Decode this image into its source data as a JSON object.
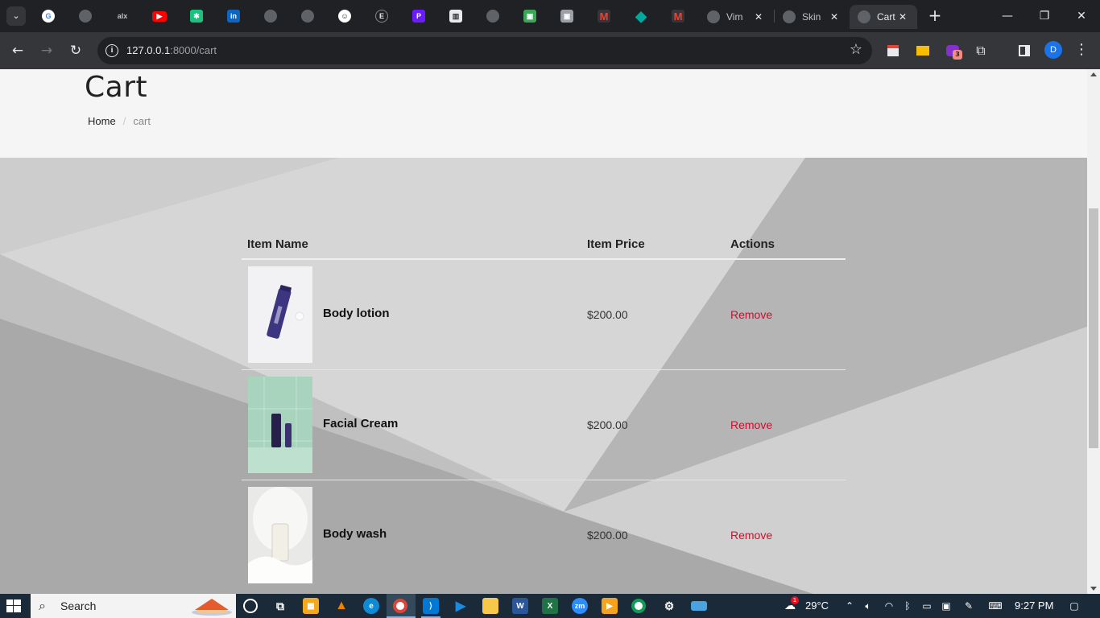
{
  "browser": {
    "tabs": [
      {
        "title": "Vim",
        "close": "✕"
      },
      {
        "title": "Skin",
        "close": "✕"
      },
      {
        "title": "Cart",
        "close": "✕",
        "active": true
      }
    ],
    "pinned_icons": [
      "google-icon",
      "github-icon",
      "alx-icon",
      "youtube-icon",
      "chatgpt-icon",
      "linkedin-icon",
      "github-icon",
      "github-icon",
      "smiley-icon",
      "e-icon",
      "p-icon",
      "trello-icon",
      "github-icon",
      "app-icon",
      "app-icon",
      "gmail-icon",
      "diamond-icon",
      "gmail-icon"
    ],
    "pinned_labels": {
      "alx": "alx",
      "linkedin": "in"
    },
    "new_tab": "+",
    "window_controls": {
      "minimize": "—",
      "restore": "❐",
      "close": "✕"
    },
    "url": {
      "host": "127.0.0.1",
      "path": ":8000/cart"
    },
    "extension_badge": "3",
    "profile_initial": "D"
  },
  "page": {
    "title": "Cart",
    "breadcrumb": {
      "home": "Home",
      "separator": "/",
      "current": "cart"
    },
    "table": {
      "headers": {
        "name": "Item Name",
        "price": "Item Price",
        "actions": "Actions"
      },
      "rows": [
        {
          "name": "Body lotion",
          "price": "$200.00",
          "action": "Remove"
        },
        {
          "name": "Facial Cream",
          "price": "$200.00",
          "action": "Remove"
        },
        {
          "name": "Body wash",
          "price": "$200.00",
          "action": "Remove"
        }
      ]
    },
    "colors": {
      "remove": "#c8102e",
      "header_bg": "#f5f5f5"
    }
  },
  "taskbar": {
    "search_label": "Search",
    "weather": "29°C",
    "weather_badge": "1",
    "time": "9:27 PM",
    "apps": [
      "cortana-icon",
      "task-view-icon",
      "store-icon",
      "vlc-icon",
      "edge-icon",
      "chrome-icon",
      "vscode-icon",
      "media-player-icon",
      "file-explorer-icon",
      "word-icon",
      "excel-icon",
      "zoom-icon",
      "video-icon",
      "chrome-icon",
      "network-tool-icon",
      "keyboard-icon"
    ],
    "zoom_label": "zm"
  }
}
